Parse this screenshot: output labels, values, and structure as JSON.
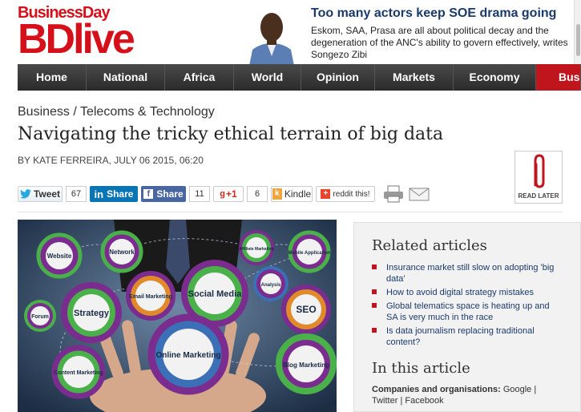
{
  "header": {
    "logo_top": "BusinessDay",
    "logo_main": "BDlive",
    "promo_title": "Too many actors keep SOE drama going",
    "promo_text": "Eskom, SAA, Prasa are all about political decay and the degeneration of the ANC's ability to govern effectively, writes Songezo Zibi"
  },
  "nav": {
    "items": [
      "Home",
      "National",
      "Africa",
      "World",
      "Opinion",
      "Markets",
      "Economy",
      "Busin"
    ]
  },
  "article": {
    "breadcrumb": "Business / Telecoms & Technology",
    "title": "Navigating the tricky ethical terrain of big data",
    "byline": "BY KATE FERREIRA, JULY 06 2015, 06:20"
  },
  "share": {
    "tweet_label": "Tweet",
    "tweet_count": "67",
    "linkedin_label": "Share",
    "facebook_label": "Share",
    "facebook_count": "11",
    "gplus_label": "+1",
    "gplus_count": "6",
    "kindle_label": "Kindle",
    "reddit_label": "reddit this!"
  },
  "read_later": {
    "label": "READ LATER"
  },
  "hero": {
    "gears": {
      "website": "Website",
      "network": "Network",
      "affiliate": "Affiliate Marketing",
      "mobile": "Mobile Application",
      "social": "Social Media",
      "analysis": "Analysis",
      "email": "Email Marketing",
      "strategy": "Strategy",
      "forum": "Forum",
      "seo": "SEO",
      "online": "Online Marketing",
      "content": "Content Marketing",
      "blog": "Blog Marketing"
    }
  },
  "sidebar": {
    "related_title": "Related articles",
    "related": [
      "Insurance market still slow on adopting 'big data'",
      "How to avoid digital strategy mistakes",
      "Global telematics space is heating up and SA is very much in the race",
      "Is data journalism replacing traditional content?"
    ],
    "in_article_title": "In this article",
    "companies_label": "Companies and organisations:",
    "companies_value": "Google | Twitter | Facebook"
  },
  "colors": {
    "brand_red": "#d6101a",
    "nav_dark": "#333333",
    "link_blue": "#1a3a6b"
  }
}
